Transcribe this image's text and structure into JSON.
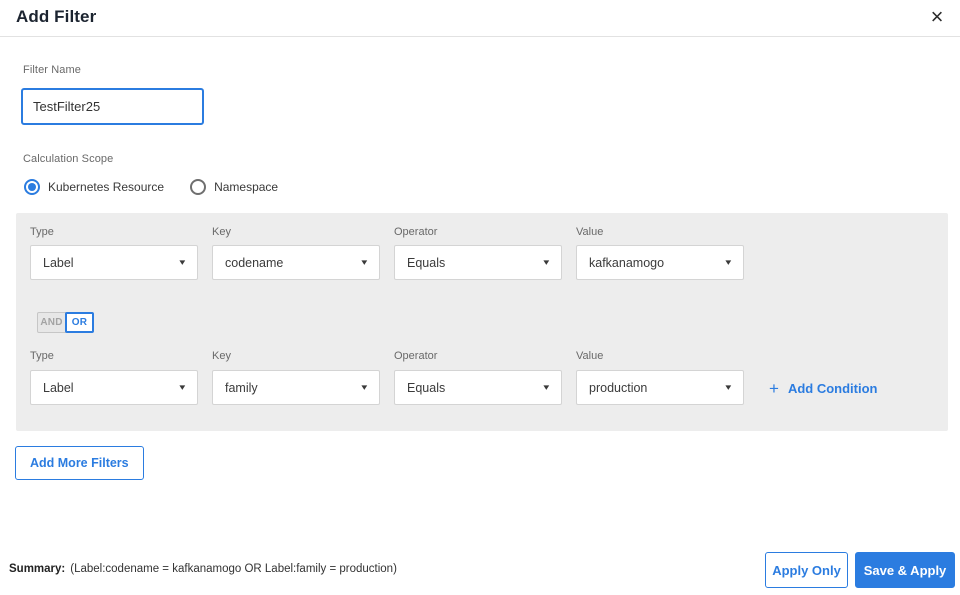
{
  "dialog": {
    "title": "Add Filter",
    "close_icon": "×"
  },
  "filter_name": {
    "label": "Filter Name",
    "value": "TestFilter25"
  },
  "calculation_scope": {
    "label": "Calculation Scope",
    "options": [
      {
        "label": "Kubernetes Resource",
        "selected": true
      },
      {
        "label": "Namespace",
        "selected": false
      }
    ]
  },
  "conditions": {
    "field_labels": {
      "type": "Type",
      "key": "Key",
      "operator": "Operator",
      "value": "Value"
    },
    "rows": [
      {
        "type": "Label",
        "key": "codename",
        "operator": "Equals",
        "value": "kafkanamogo"
      },
      {
        "type": "Label",
        "key": "family",
        "operator": "Equals",
        "value": "production"
      }
    ],
    "logic_toggle": {
      "and_label": "AND",
      "or_label": "OR",
      "selected": "OR"
    },
    "add_condition": {
      "plus_icon": "+",
      "label": "Add Condition"
    },
    "caret_icon": "▾"
  },
  "add_more_filters_label": "Add More Filters",
  "footer": {
    "summary_label": "Summary:",
    "summary_value": "(Label:codename = kafkanamogo OR Label:family = production)",
    "apply_only_label": "Apply Only",
    "save_apply_label": "Save & Apply"
  },
  "colors": {
    "accent": "#2b7ce0",
    "panel_bg": "#ededed",
    "divider": "#e2e2e2"
  }
}
